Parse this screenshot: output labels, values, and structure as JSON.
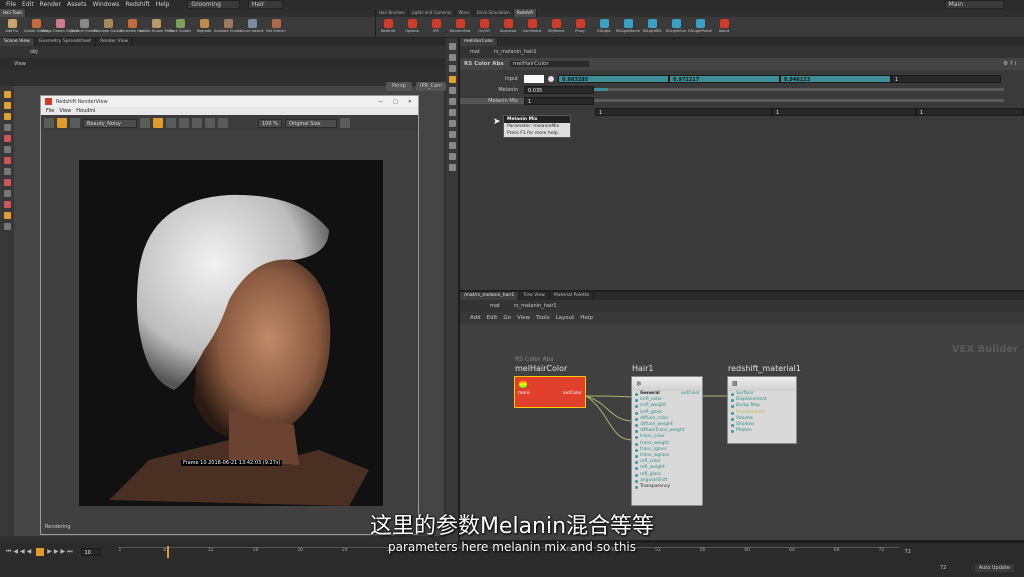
{
  "menu": [
    "File",
    "Edit",
    "Render",
    "Assets",
    "Windows",
    "Redshift",
    "Help"
  ],
  "desktop": "Grooming",
  "context": "Hair",
  "workspace": "Main",
  "shelf_left_tabs": [
    "Hair Tools"
  ],
  "shelf_left_tools": [
    "Add Fur",
    "Create Guides",
    "Merge Groom Objects",
    "Deform Guides",
    "Simulate Guides",
    "Generate Hair",
    "Isolate Groom Parts",
    "Plant Guides",
    "Regrade",
    "Animate Guides",
    "Curve Advect",
    "Set Directn"
  ],
  "shelf_right_tabs": [
    "Hair Brushes",
    "Lights and Cameras",
    "Wires",
    "Drive Simulation",
    "Redshift"
  ],
  "shelf_right_tools": [
    "Redshift",
    "Options",
    "IPR",
    "RenderView",
    "On/Off",
    "Snapshot",
    "CamParms",
    "ObjParms",
    "Proxy",
    "RSLight",
    "RSLightDome",
    "RSLightIES",
    "RSLightSun",
    "RSLightPortal",
    "About"
  ],
  "left_pane_tabs": [
    "Scene View",
    "Geometry Spreadsheet",
    "Render View"
  ],
  "path_obj": "obj",
  "view_label": "View",
  "persp": "Persp",
  "cam": "IPR_Cam",
  "renderview": {
    "title": "Redshift RenderView",
    "menu": [
      "File",
      "View",
      "Houdini"
    ],
    "aov": "Beauty_Noisy",
    "zoom": "100 %",
    "size_mode": "Original Size",
    "frame_info": "Frame 10  2018-06-21  13:42:03  (9.27s)",
    "status": "Rendering"
  },
  "param_pane": {
    "tab": "melHairColor",
    "node_type": "RS Color Abs",
    "node_name": "melHairColor",
    "input_label": "Input",
    "input_vals": [
      "0.983285",
      "0.972217",
      "0.946123",
      "1"
    ],
    "melanin_label": "Melanin",
    "melanin_val": "0.035",
    "melanin_mix_label": "Melanin Mix",
    "melanin_mix_val": "1",
    "row4_vals": [
      "1",
      "1",
      "1"
    ],
    "tooltip_title": "Melanin Mix",
    "tooltip_param": "Parameter: melaninMix",
    "tooltip_help": "Press F1 for more help.",
    "path_mat": "mat",
    "path_node": "rs_melanin_hair1"
  },
  "network": {
    "tabs": [
      "/mat/rs_melanin_hair1",
      "Tree View",
      "Material Palette"
    ],
    "path_mat": "mat",
    "path_node": "rs_melanin_hair1",
    "menu": [
      "Add",
      "Edit",
      "Go",
      "View",
      "Tools",
      "Layout",
      "Help"
    ],
    "watermark": "VEX Builder",
    "node1": {
      "type": "RS Color Abs",
      "name": "melHairColor",
      "in": "more",
      "out": "outColor"
    },
    "node2": {
      "name": "Hair1",
      "out": "outColor",
      "inputs": [
        "General",
        "irefl_color",
        "irefl_weight",
        "irefl_gloss",
        "diffuse_color",
        "diffuse_weight",
        "diffuseTrans_weight",
        "trans_color",
        "trans_weight",
        "trans_lgloss",
        "trans_wgloss",
        "refl_color",
        "refl_weight",
        "refl_gloss",
        "angularShift",
        "Transparency"
      ]
    },
    "node3": {
      "name": "redshift_material1",
      "inputs": [
        "Surface",
        "Displacement",
        "Bump Map",
        "Environment",
        "Volume",
        "Shadow",
        "Photon"
      ]
    }
  },
  "timeline": {
    "frame": "10",
    "end": "72",
    "end2": "72",
    "ticks": [
      "1",
      "8",
      "12",
      "16",
      "20",
      "24",
      "28",
      "32",
      "36",
      "40",
      "44",
      "48",
      "52",
      "56",
      "60",
      "64",
      "68",
      "72"
    ],
    "auto_update": "Auto Update"
  },
  "subtitle_cn": "这里的参数Melanin混合等等",
  "subtitle_en": "parameters here melanin mix and so this",
  "colors": {
    "teal": "#3e8f95",
    "node_red": "#e0402c",
    "wire": "#a8b86a"
  }
}
